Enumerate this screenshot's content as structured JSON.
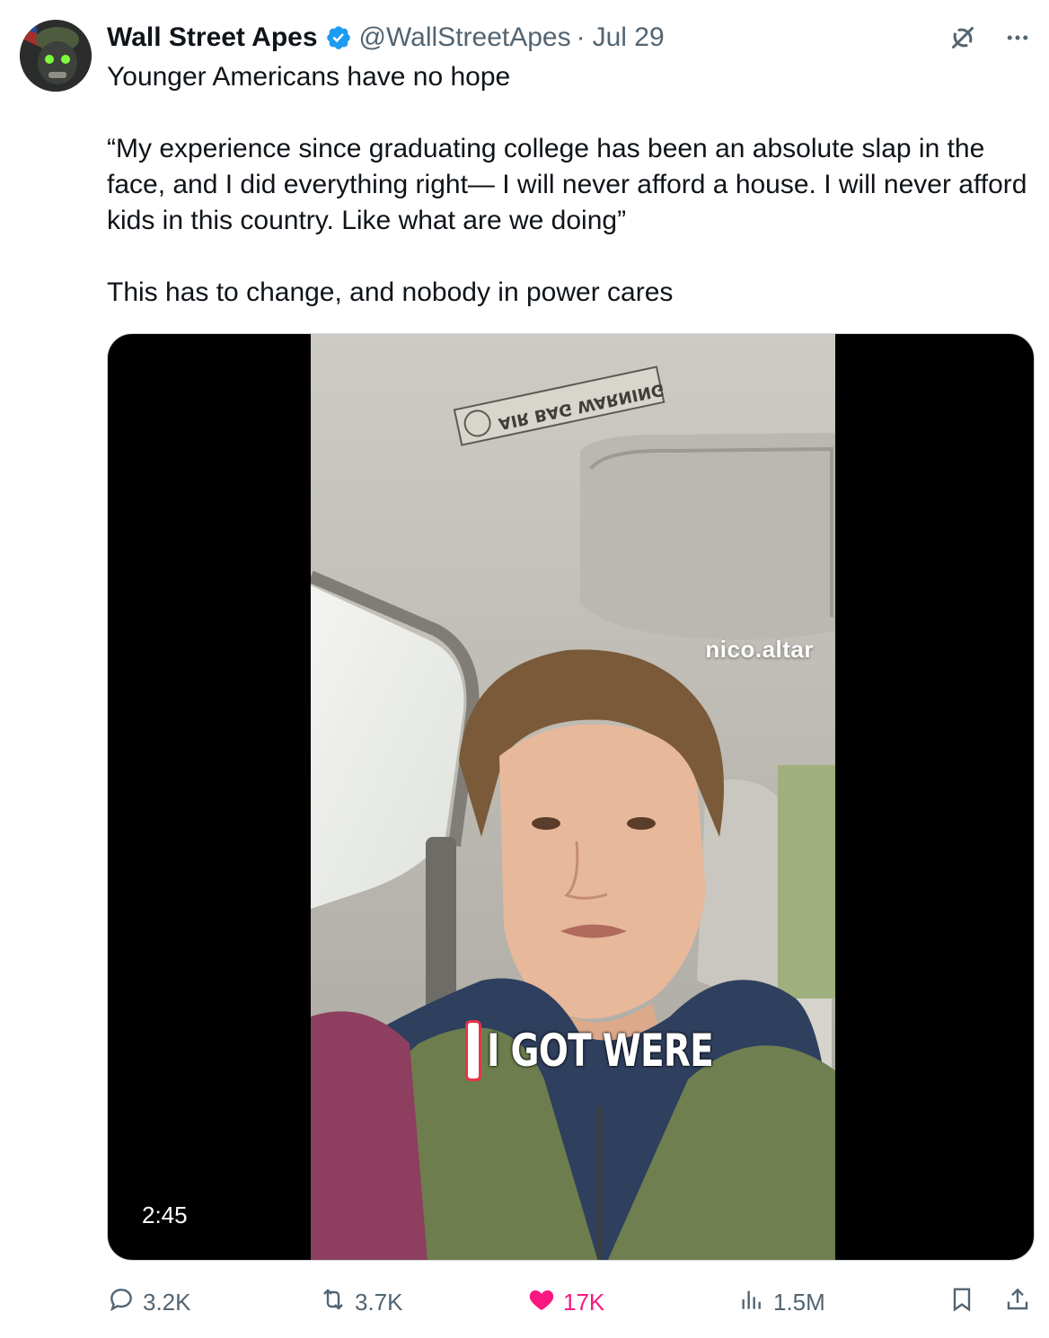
{
  "tweet": {
    "display_name": "Wall Street Apes",
    "handle": "@WallStreetApes",
    "separator": "·",
    "date": "Jul 29",
    "verified": true,
    "text_lines": [
      "Younger Americans have no hope",
      "“My experience since graduating college has been an absolute slap in the face, and I did everything right— I will never afford a house. I will never afford kids in this country. Like what are we doing”",
      "This has to change, and nobody in power cares"
    ]
  },
  "media": {
    "type": "video",
    "duration": "2:45",
    "watermark": "nico.altar",
    "caption": "I GOT WERE",
    "sticker_text": "AIR BAG WARNING"
  },
  "actions": {
    "replies": "3.2K",
    "reposts": "3.7K",
    "likes": "17K",
    "views": "1.5M"
  },
  "icons": {
    "top_right": [
      "grok-icon",
      "more-icon"
    ],
    "bar": [
      "reply-icon",
      "repost-icon",
      "like-icon",
      "views-icon",
      "bookmark-icon",
      "share-icon"
    ]
  },
  "colors": {
    "text": "#0f1419",
    "muted": "#536471",
    "verified": "#1d9bf0",
    "like": "#f91880"
  }
}
